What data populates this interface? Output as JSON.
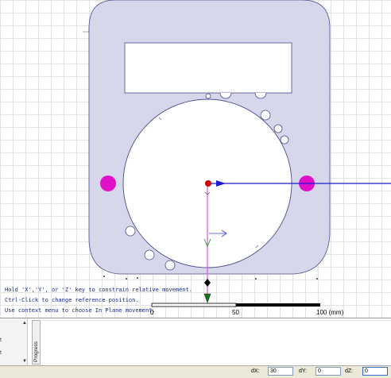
{
  "hints": [
    "Hold 'X','Y', or 'Z' key to constrain relative movement.",
    "Ctrl-Click to change reference position.",
    "Use context menu to choose In Plane movement."
  ],
  "scale_bar": {
    "labels": [
      "0",
      "50",
      "100 (mm)"
    ]
  },
  "bottom_panel": {
    "progress_tab_label": "Progress",
    "left_strip_items": [
      "t",
      "t"
    ]
  },
  "status_bar": {
    "dx_label": "dX:",
    "dx_value": "30",
    "dy_label": "dY:",
    "dy_value": "0",
    "dz_label": "dZ:",
    "dz_value": "0"
  },
  "colors": {
    "part_fill": "#d7d7ec",
    "part_stroke": "#4a4a8a",
    "pink_point": "#e010c8",
    "x_axis": "#1b1bd6",
    "z_axis": "#e060e0",
    "origin": "#cc0000"
  }
}
